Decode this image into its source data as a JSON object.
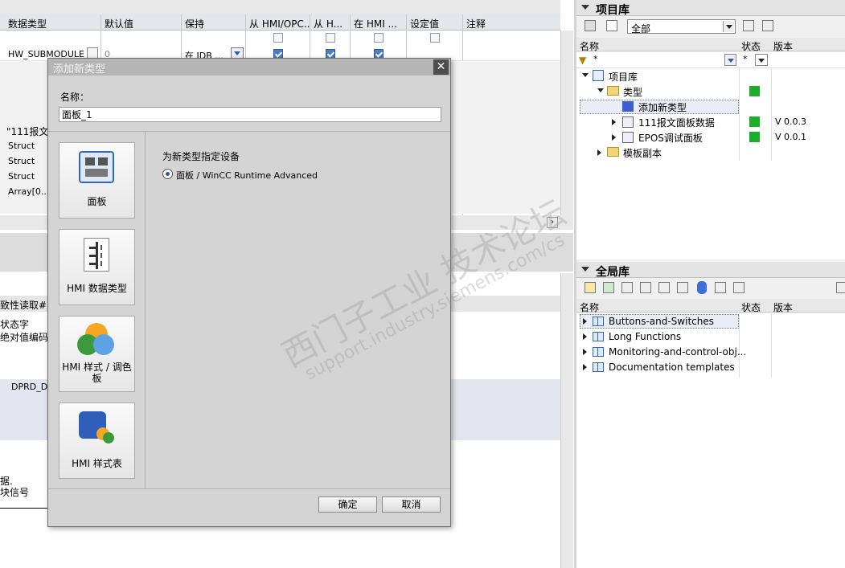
{
  "left_table": {
    "columns": [
      "数据类型",
      "默认值",
      "保持",
      "从 HMI/OPC..",
      "从 H...",
      "在 HMI ...",
      "设定值",
      "注释"
    ],
    "row1": {
      "type": "HW_SUBMODULE",
      "default": "0",
      "retain": "在 IDB ..."
    },
    "types": [
      "\"111报文",
      "Struct",
      "Struct",
      "Struct",
      "Array[0..1"
    ],
    "lower_texts": [
      "致性读取#",
      "状态字",
      "绝对值编码",
      "DPRD_D",
      "据.",
      "块信号"
    ]
  },
  "project_library": {
    "title": "项目库",
    "filter_value": "全部",
    "columns": {
      "name": "名称",
      "status": "状态",
      "version": "版本"
    },
    "name_filter": "*",
    "status_filter": "*",
    "tree": [
      {
        "label": "项目库"
      },
      {
        "label": "类型"
      },
      {
        "label": "添加新类型"
      },
      {
        "label": "111报文面板数据",
        "version": "V 0.0.3"
      },
      {
        "label": "EPOS调试面板",
        "version": "V 0.0.1"
      },
      {
        "label": "模板副本"
      }
    ]
  },
  "global_library": {
    "title": "全局库",
    "columns": {
      "name": "名称",
      "status": "状态",
      "version": "版本"
    },
    "items": [
      "Buttons-and-Switches",
      "Long Functions",
      "Monitoring-and-control-obj...",
      "Documentation templates"
    ]
  },
  "dialog": {
    "title": "添加新类型",
    "name_label": "名称：",
    "name_value": "面板_1",
    "tiles": [
      "面板",
      "HMI 数据类型",
      "HMI 样式 / 调色板",
      "HMI 样式表"
    ],
    "device_heading": "为新类型指定设备",
    "device_option": "面板 / WinCC Runtime Advanced",
    "ok": "确定",
    "cancel": "取消"
  },
  "watermark": {
    "line1": "西门子工业  技术论坛",
    "line2": "support.industry.siemens.com/cs"
  },
  "colors": {
    "status_ok": "#1cae2a",
    "accent": "#3566b0"
  }
}
